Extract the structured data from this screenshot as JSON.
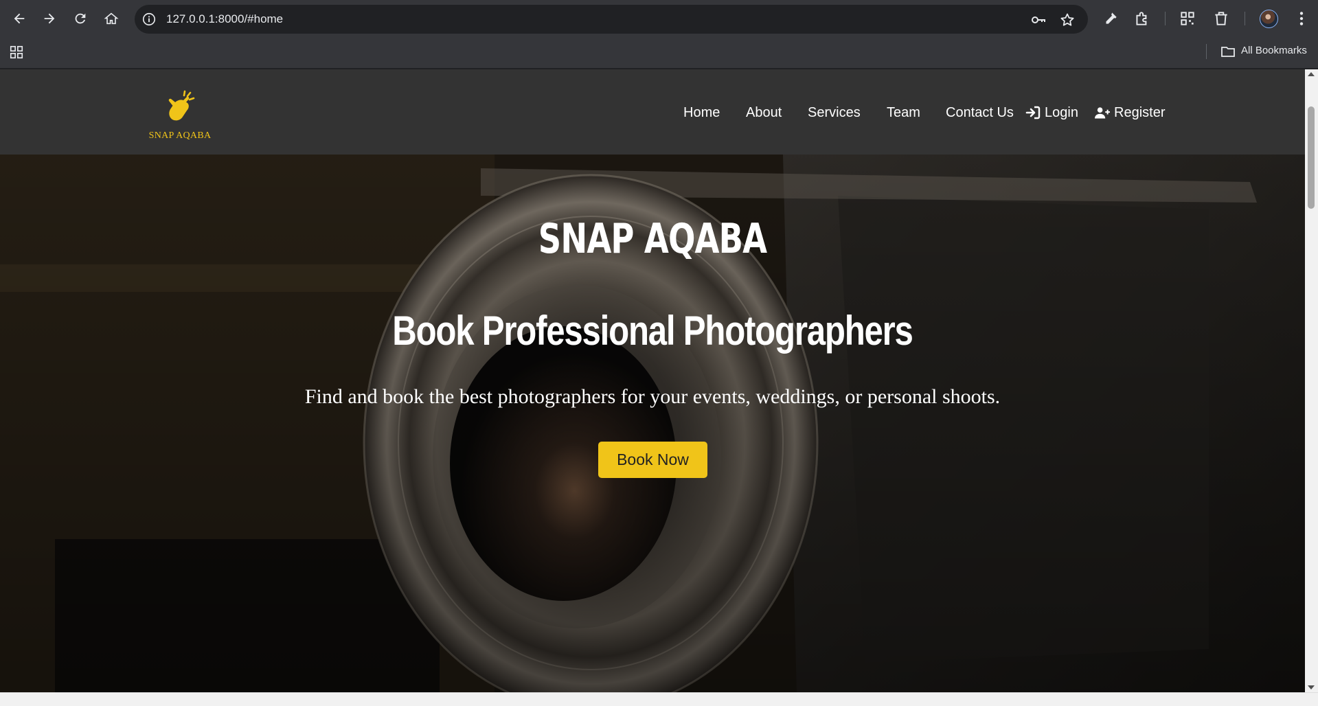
{
  "browser": {
    "url": "127.0.0.1:8000/#home",
    "bookmarks_label": "All Bookmarks"
  },
  "site": {
    "logo_text": "SNAP AQABA",
    "nav": {
      "home": "Home",
      "about": "About",
      "services": "Services",
      "team": "Team",
      "contact": "Contact Us",
      "login": "Login",
      "register": "Register"
    }
  },
  "hero": {
    "title": "SNAP AQABA",
    "heading": "Book Professional Photographers",
    "subtitle": "Find and book the best photographers for your events, weddings, or personal shoots.",
    "cta": "Book Now"
  },
  "icons": {
    "back": "back-arrow-icon",
    "forward": "forward-arrow-icon",
    "reload": "reload-icon",
    "home": "home-icon",
    "info": "info-icon",
    "key": "key-icon",
    "star": "star-icon",
    "eyedropper": "eyedropper-icon",
    "extensions": "puzzle-icon",
    "qr": "qr-code-icon",
    "trash": "trash-icon",
    "menu": "kebab-menu-icon",
    "apps": "apps-grid-icon",
    "folder": "folder-icon",
    "login": "sign-in-icon",
    "register": "user-plus-icon"
  },
  "colors": {
    "accent": "#f0c419",
    "navbar": "#333333",
    "chrome": "#35363a"
  }
}
